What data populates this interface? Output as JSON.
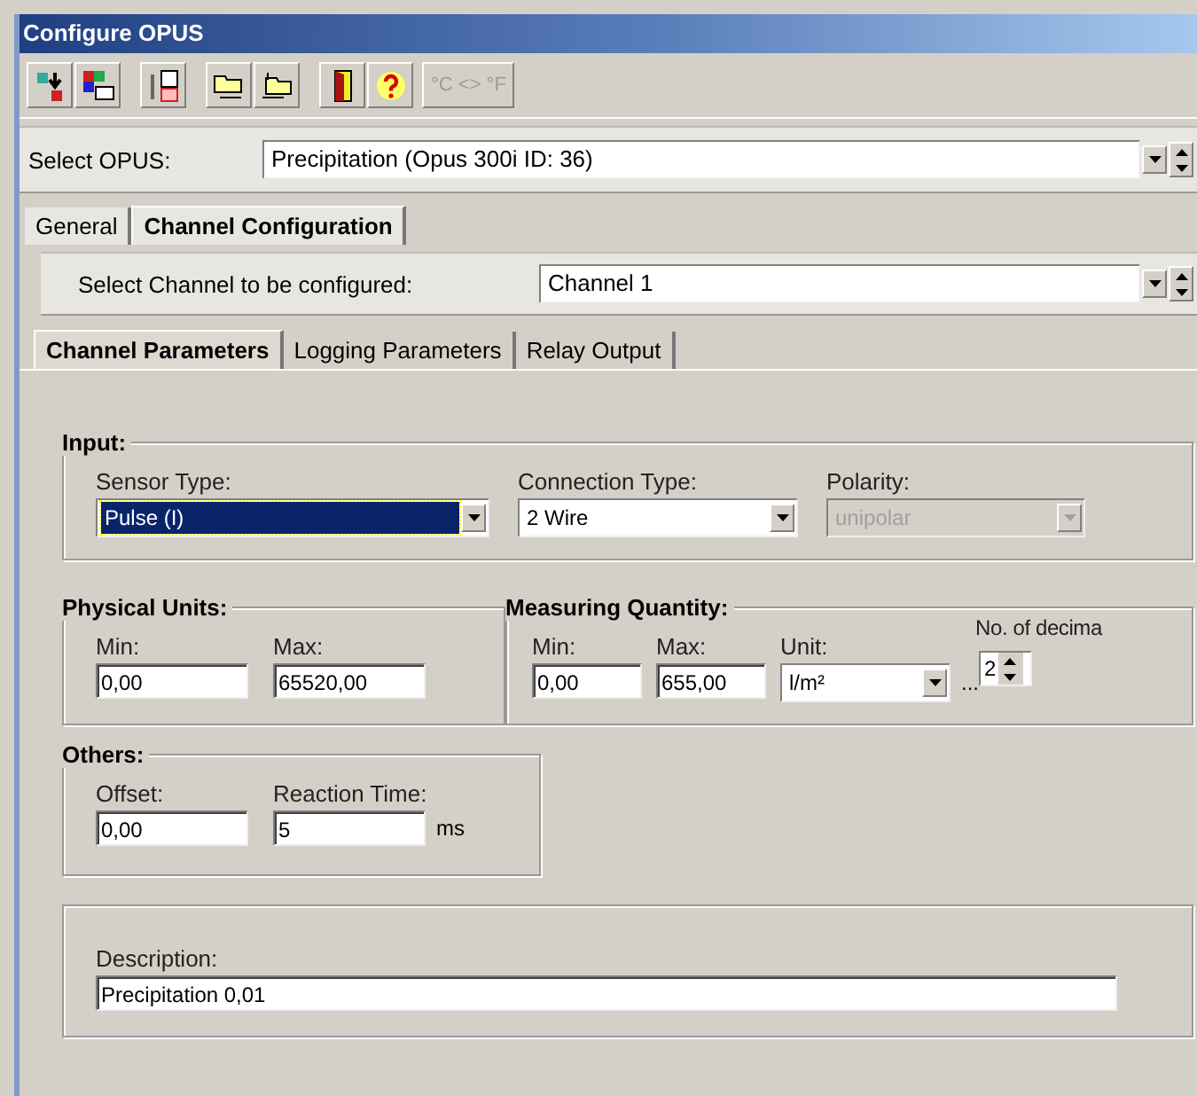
{
  "window": {
    "title": "Configure OPUS"
  },
  "toolbar": [
    {
      "buttons": [
        {
          "kind": "import",
          "disabled": false
        },
        {
          "kind": "export",
          "disabled": false
        }
      ]
    },
    {
      "buttons": [
        {
          "kind": "sheet",
          "disabled": false
        }
      ]
    },
    {
      "buttons": [
        {
          "kind": "folder_in",
          "disabled": false
        },
        {
          "kind": "folder_out",
          "disabled": false
        }
      ]
    },
    {
      "buttons": [
        {
          "kind": "exit",
          "disabled": false
        },
        {
          "kind": "help",
          "disabled": false
        },
        {
          "kind": "text",
          "label": "°C <> °F",
          "disabled": true
        }
      ]
    }
  ],
  "opus_select": {
    "label": "Select OPUS:",
    "value": "Precipitation (Opus 300i ID: 36)"
  },
  "tabs": [
    {
      "label": "General",
      "selected": false
    },
    {
      "label": "Channel Configuration",
      "selected": true
    }
  ],
  "channel_select": {
    "label": "Select Channel to be configured:",
    "value": "Channel 1"
  },
  "subtabs": [
    {
      "label": "Channel Parameters",
      "selected": true
    },
    {
      "label": "Logging Parameters",
      "selected": false
    },
    {
      "label": "Relay Output",
      "selected": false
    }
  ],
  "groups": [
    {
      "title": "Input:",
      "fields": [
        {
          "kind": "combo",
          "label": "Sensor Type:",
          "value": "Pulse (I)",
          "focused": true,
          "disabled": false
        },
        {
          "kind": "combo",
          "label": "Connection Type:",
          "value": "2 Wire",
          "focused": false,
          "disabled": false
        },
        {
          "kind": "combo",
          "label": "Polarity:",
          "value": "unipolar",
          "focused": false,
          "disabled": true
        }
      ]
    },
    {
      "title": "Physical Units:",
      "fields": [
        {
          "kind": "text",
          "label": "Min:",
          "value": "0,00"
        },
        {
          "kind": "text",
          "label": "Max:",
          "value": "65520,00"
        }
      ]
    },
    {
      "title": "Measuring Quantity:",
      "fields": [
        {
          "kind": "text",
          "label": "Min:",
          "value": "0,00"
        },
        {
          "kind": "text",
          "label": "Max:",
          "value": "655,00"
        },
        {
          "kind": "combo",
          "label": "Unit:",
          "value": "l/m²",
          "suffix": "..."
        },
        {
          "kind": "spin",
          "label": "No. of decima",
          "value": "2"
        }
      ]
    },
    {
      "title": "Others:",
      "fields": [
        {
          "kind": "text",
          "label": "Offset:",
          "value": "0,00"
        },
        {
          "kind": "text",
          "label": "Reaction Time:",
          "value": "5",
          "suffix": "ms"
        }
      ]
    },
    {
      "fields": [
        {
          "kind": "text",
          "label": "Description:",
          "value": "Precipitation 0,01"
        }
      ]
    }
  ]
}
